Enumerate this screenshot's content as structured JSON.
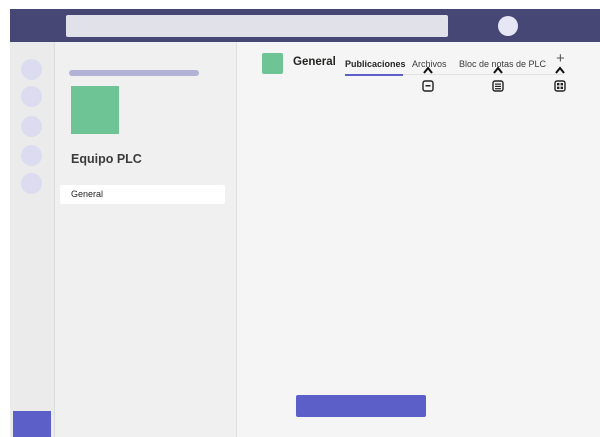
{
  "colors": {
    "app_bar": "#464775",
    "accent": "#5b5fc7",
    "team_logo": "#6ec494",
    "search_bg": "#e1e1e9",
    "panel_bg": "#f0f0f0",
    "content_bg": "#f5f5f5"
  },
  "header": {
    "search": {
      "placeholder": ""
    }
  },
  "left_rail": {
    "items": [
      "rail-dot",
      "rail-dot",
      "rail-dot",
      "rail-dot",
      "rail-dot"
    ]
  },
  "teams_panel": {
    "team_name": "Equipo PLC",
    "channels": [
      {
        "label": "General",
        "selected": true
      }
    ]
  },
  "channel": {
    "title": "General",
    "tabs": [
      {
        "label": "Publicaciones",
        "active": true
      },
      {
        "label": "Archivos",
        "active": false
      },
      {
        "label": "Bloc de notas de PLC",
        "active": false
      }
    ],
    "add_tab_label": "+",
    "tab_icons": [
      "chevron-up-icon",
      "file-icon",
      "notebook-icon",
      "apps-icon"
    ]
  }
}
